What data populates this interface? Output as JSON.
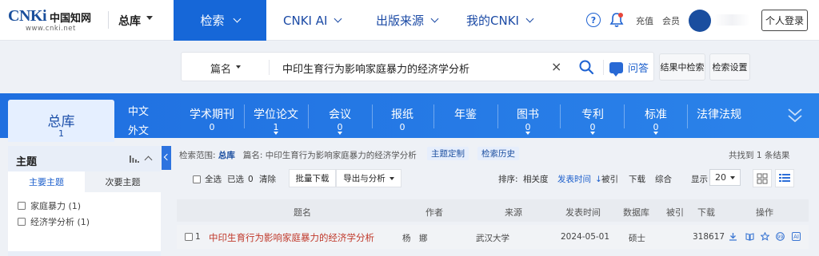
{
  "brand": {
    "logo_text": "CNKi",
    "logo_cn": "中国知网",
    "url": "www.cnki.net"
  },
  "topnav": {
    "library": "总库",
    "search": "检索",
    "cnki_ai": "CNKI AI",
    "sources": "出版来源",
    "my_cnki": "我的CNKI",
    "recharge": "充值",
    "member": "会员",
    "login": "个人登录",
    "help_glyph": "?"
  },
  "search": {
    "field": "篇名",
    "query": "中印生育行为影响家庭暴力的经济学分析",
    "clear": "×",
    "ask": "问答",
    "within_results": "结果中检索",
    "settings": "检索设置"
  },
  "categories": {
    "main": {
      "label": "总库",
      "count": "1"
    },
    "lang_cn": "中文",
    "lang_foreign": "外文",
    "items": [
      {
        "label": "学术期刊",
        "count": "0"
      },
      {
        "label": "学位论文",
        "count": "1"
      },
      {
        "label": "会议",
        "count": "0"
      },
      {
        "label": "报纸",
        "count": "0"
      },
      {
        "label": "年鉴",
        "count": ""
      },
      {
        "label": "图书",
        "count": "0"
      },
      {
        "label": "专利",
        "count": "0"
      },
      {
        "label": "标准",
        "count": "0"
      },
      {
        "label": "法律法规",
        "count": ""
      }
    ]
  },
  "sidebar": {
    "title": "主题",
    "tab_primary": "主要主题",
    "tab_secondary": "次要主题",
    "options": [
      {
        "label": "家庭暴力 (1)"
      },
      {
        "label": "经济学分析 (1)"
      }
    ]
  },
  "results": {
    "scope_label": "检索范围:",
    "scope_value": "总库",
    "scope_query": "篇名: 中印生育行为影响家庭暴力的经济学分析",
    "topic_custom": "主题定制",
    "history": "检索历史",
    "found": "共找到 1 条结果",
    "select_all": "全选",
    "selected": "已选",
    "selected_count": "0",
    "clear": "清除",
    "batch_download": "批量下载",
    "export": "导出与分析",
    "sort_label": "排序:",
    "sort_options": [
      "相关度",
      "发表时间",
      "被引",
      "下载",
      "综合"
    ],
    "sort_arrow": "↓",
    "display_label": "显示",
    "page_size": "20",
    "columns": [
      "题名",
      "作者",
      "来源",
      "发表时间",
      "数据库",
      "被引",
      "下载",
      "操作"
    ],
    "rows": [
      {
        "index": "1",
        "title": "中印生育行为影响家庭暴力的经济学分析",
        "author": "杨　娜",
        "source": "武汉大学",
        "date": "2024-05-01",
        "database": "硕士",
        "cited": "",
        "downloads": "318617",
        "ai": "AI"
      }
    ]
  }
}
